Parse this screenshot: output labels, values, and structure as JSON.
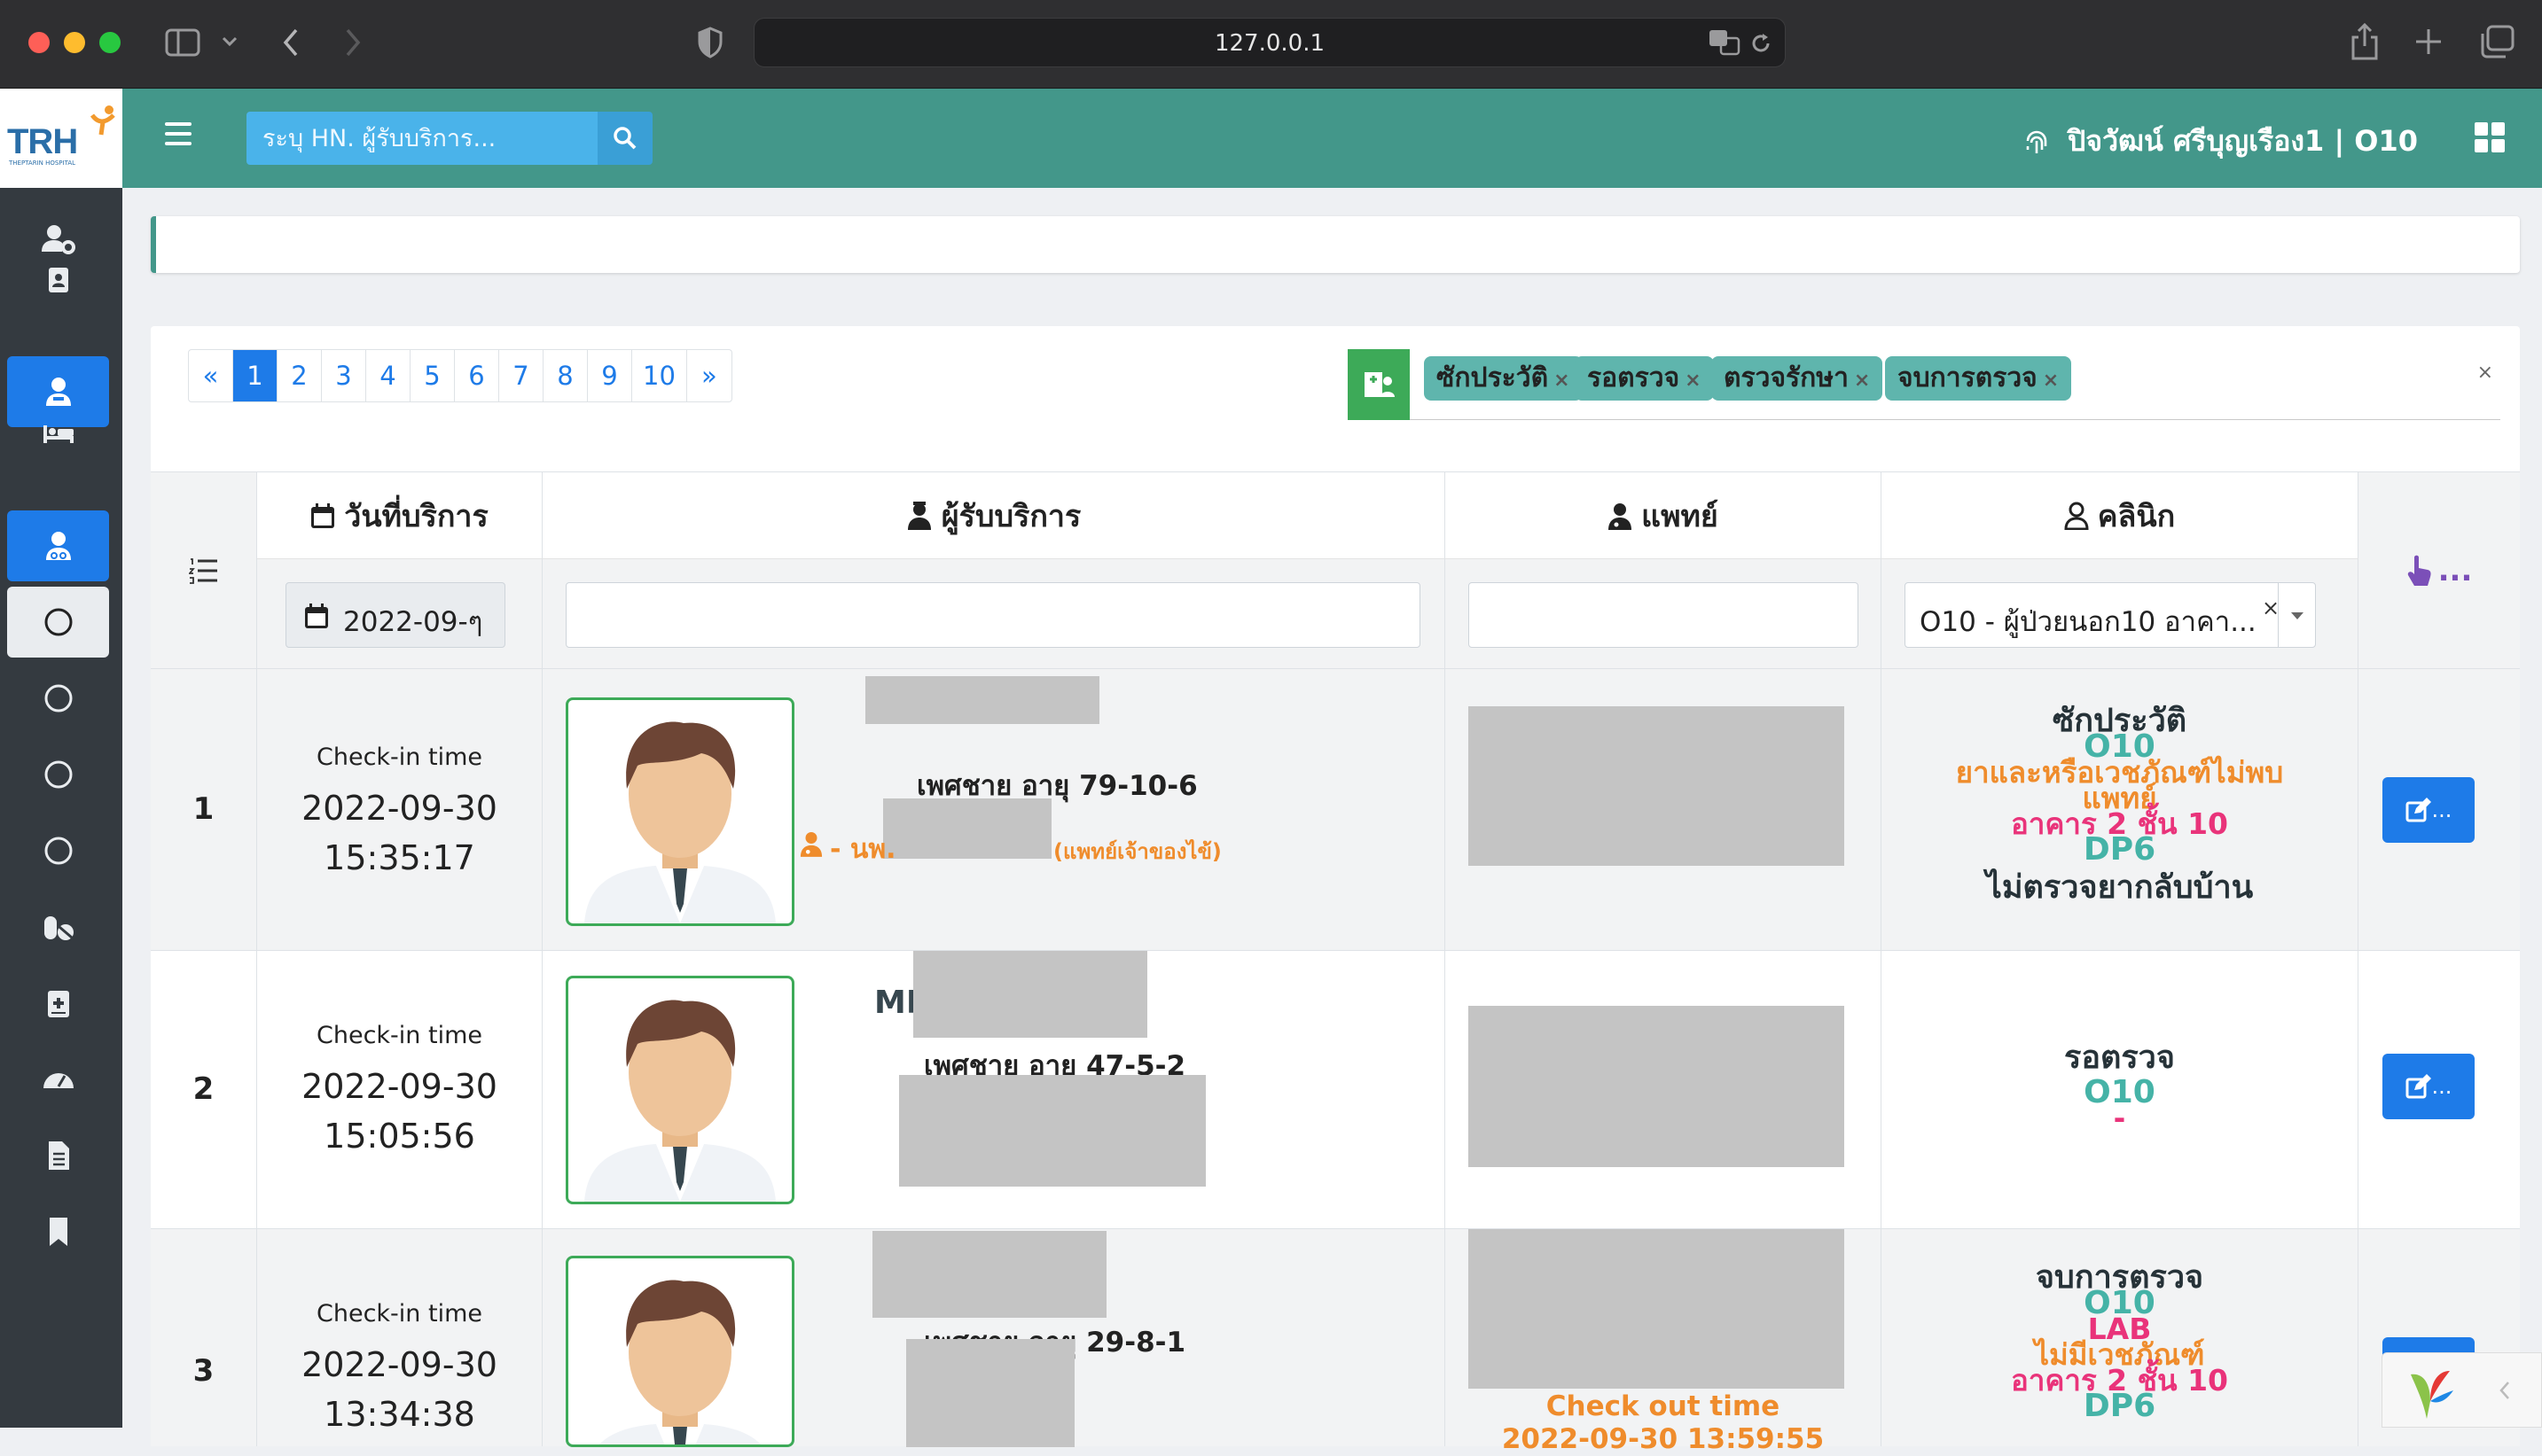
{
  "browser": {
    "url": "127.0.0.1",
    "colors": {
      "close": "#fe5f57",
      "minimize": "#febc2e",
      "maximize": "#28c840"
    }
  },
  "header": {
    "logo_text": "TRH",
    "logo_subtext": "THEPTARIN HOSPITAL",
    "search_placeholder": "ระบุ HN. ผู้รับบริการ...",
    "user_label": "ปิจวัฒน์ ศรีบุญเรือง1 | O10",
    "accent": "#43978a"
  },
  "sidebar": {
    "items": [
      {
        "icon": "user-cog-icon",
        "state": "normal"
      },
      {
        "icon": "address-card-icon",
        "state": "normal"
      },
      {
        "icon": "user-injured-icon",
        "state": "active"
      },
      {
        "icon": "bed-icon",
        "state": "normal"
      },
      {
        "icon": "user-md-icon",
        "state": "active"
      },
      {
        "icon": "circle-icon",
        "state": "selected"
      },
      {
        "icon": "circle-icon",
        "state": "normal"
      },
      {
        "icon": "circle-icon",
        "state": "normal"
      },
      {
        "icon": "circle-icon",
        "state": "normal"
      },
      {
        "icon": "pills-icon",
        "state": "normal"
      },
      {
        "icon": "notes-medical-icon",
        "state": "normal"
      },
      {
        "icon": "tachometer-icon",
        "state": "normal"
      },
      {
        "icon": "file-alt-icon",
        "state": "normal"
      },
      {
        "icon": "bookmark-icon",
        "state": "normal"
      }
    ]
  },
  "pagination": {
    "prev": "«",
    "pages": [
      "1",
      "2",
      "3",
      "4",
      "5",
      "6",
      "7",
      "8",
      "9",
      "10"
    ],
    "current": "1",
    "next": "»"
  },
  "status_filter": {
    "chips": [
      "ซักประวัติ",
      "รอตรวจ",
      "ตรวจรักษา",
      "จบการตรวจ"
    ],
    "remove_symbol": "×",
    "clear_symbol": "×"
  },
  "table": {
    "headers": {
      "date": "วันที่บริการ",
      "patient": "ผู้รับบริการ",
      "doctor": "แพทย์",
      "clinic": "คลินิก",
      "action_more": "..."
    },
    "filters": {
      "date_value": "2022-09-ๆ",
      "clinic_value": "O10 - ผู้ป่วยนอก10 อาคา...",
      "clinic_clear": "×"
    },
    "checkin_label": "Check-in time",
    "edit_label": "...",
    "rows": [
      {
        "num": "1",
        "date": "2022-09-30",
        "time": "15:35:17",
        "gender_age": "เพศชาย อายุ 79-10-6",
        "doctor_prefix": "- นพ.",
        "doctor_suffix": "(แพทย์เจ้าของไข้)",
        "clinic_lines": [
          {
            "text": "ซักประวัติ",
            "color": "dark"
          },
          {
            "text": "O10",
            "color": "teal"
          },
          {
            "text": "ยาและหรือเวชภัณฑ์ไม่พบ",
            "color": "orange"
          },
          {
            "text": "แพทย์",
            "color": "orange"
          },
          {
            "text": "อาคาร 2 ชั้น 10",
            "color": "pink"
          },
          {
            "text": "DP6",
            "color": "teal"
          },
          {
            "text": "ไม่ตรวจยากลับบ้าน",
            "color": "dark"
          }
        ]
      },
      {
        "num": "2",
        "date": "2022-09-30",
        "time": "15:05:56",
        "name_prefix": "MR.",
        "gender_age": "เพศชาย อายุ 47-5-2",
        "clinic_lines": [
          {
            "text": "รอตรวจ",
            "color": "dark"
          },
          {
            "text": "O10",
            "color": "teal"
          },
          {
            "text": "-",
            "color": "pink"
          }
        ]
      },
      {
        "num": "3",
        "date": "2022-09-30",
        "time": "13:34:38",
        "gender_age": "เพศชาย อายุ 29-8-1",
        "checkout_label": "Check out time",
        "checkout_value": "2022-09-30 13:59:55",
        "clinic_lines": [
          {
            "text": "จบการตรวจ",
            "color": "dark"
          },
          {
            "text": "O10",
            "color": "teal"
          },
          {
            "text": "LAB",
            "color": "pink"
          },
          {
            "text": "ไม่มีเวชภัณฑ์",
            "color": "orange"
          },
          {
            "text": "อาคาร 2 ชั้น 10",
            "color": "pink"
          },
          {
            "text": "DP6",
            "color": "teal"
          }
        ]
      }
    ]
  }
}
